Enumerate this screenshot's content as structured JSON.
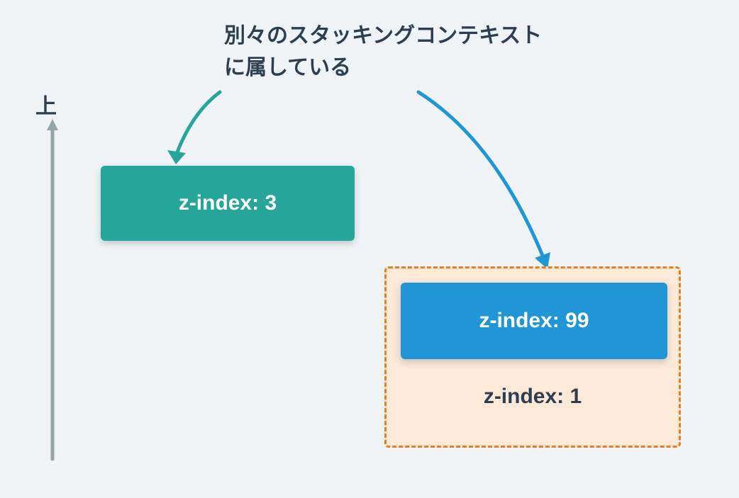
{
  "caption": {
    "line1": "別々のスタッキングコンテキスト",
    "line2": "に属している"
  },
  "axis": {
    "label": "上"
  },
  "boxes": {
    "green": {
      "text": "z-index: 3"
    },
    "blue": {
      "text": "z-index: 99"
    },
    "container": {
      "text": "z-index: 1"
    }
  },
  "colors": {
    "green": "#26a69a",
    "blue": "#2196d6",
    "orange": "#e67e22",
    "orangeFill": "#fce9d8",
    "text": "#2c3e50",
    "axis": "#95a5a6",
    "bg": "#f0f4f7"
  }
}
